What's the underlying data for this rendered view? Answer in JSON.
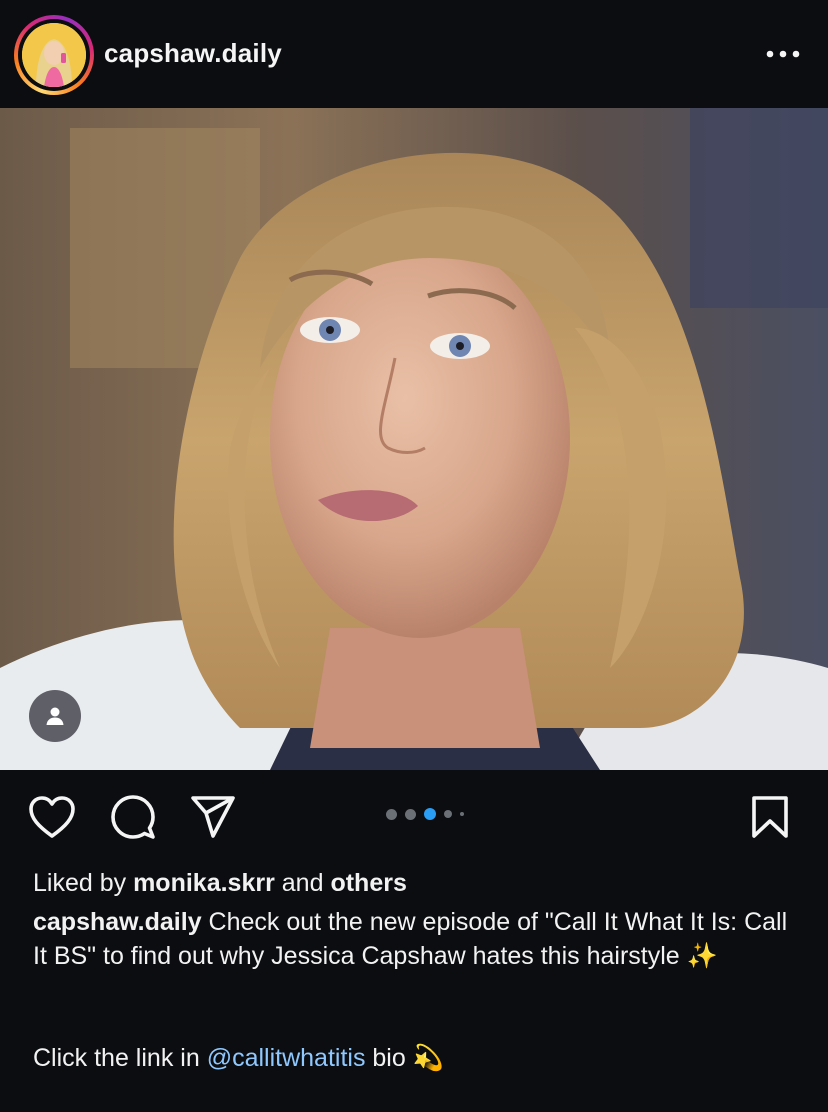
{
  "header": {
    "username": "capshaw.daily",
    "avatar_icon": "profile-photo",
    "more_icon": "more-horizontal-icon"
  },
  "post": {
    "carousel": {
      "total": 5,
      "active_index": 2
    },
    "tag_icon": "user-tag-icon"
  },
  "actions": {
    "like_icon": "heart-icon",
    "comment_icon": "comment-icon",
    "share_icon": "send-icon",
    "save_icon": "bookmark-icon"
  },
  "likes": {
    "prefix": "Liked by",
    "user": "monika.skrr",
    "middle": "and",
    "others": "others"
  },
  "caption": {
    "username": "capshaw.daily",
    "text": "Check out the new episode of \"Call It What It Is: Call It BS\" to find out why Jessica Capshaw hates this hairstyle",
    "emoji": "✨"
  },
  "cta": {
    "prefix": "Click the link in",
    "mention": "@callitwhatitis",
    "suffix": "bio",
    "emoji": "💫"
  },
  "colors": {
    "background": "#0b0d10",
    "text": "#f2f2f2",
    "mention": "#8fc8ff",
    "active_dot": "#2a9df4"
  }
}
